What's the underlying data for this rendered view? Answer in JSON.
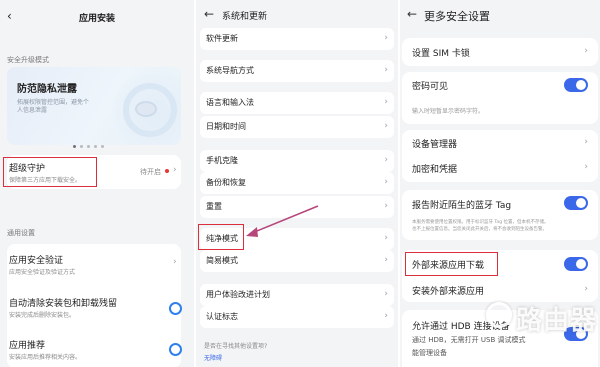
{
  "left": {
    "title": "应用安装",
    "security_mode_section": "安全升级模式",
    "banner": {
      "title": "防范隐私泄露",
      "desc_line1": "拓展权限管控范围，避免个",
      "desc_line2": "人信息泄露",
      "page_count": 5,
      "active_page": 1
    },
    "super_guard": {
      "title": "超级守护",
      "subtitle": "保障第三方应用下载安全。",
      "status": "待开启"
    },
    "general_section": "通用设置",
    "items": [
      {
        "title": "应用安全验证",
        "subtitle": "应用安全验证及验证方式"
      },
      {
        "title": "自动清除安装包和卸载残留",
        "subtitle": "安装完成后删除安装包。"
      },
      {
        "title": "应用推荐",
        "subtitle": "安装应用后推荐相关内容。"
      }
    ]
  },
  "middle": {
    "title": "系统和更新",
    "rows": [
      "软件更新",
      "系统导航方式",
      "语言和输入法",
      "日期和时间",
      "手机克隆",
      "备份和恢复",
      "重置",
      "纯净模式",
      "简易模式",
      "用户体验改进计划",
      "认证标志"
    ],
    "footer_q": "是否在寻找其他设置项?",
    "footer_link": "无障碍"
  },
  "right": {
    "title": "更多安全设置",
    "sim_lock": "设置 SIM 卡锁",
    "password_visible": {
      "label": "密码可见",
      "subtitle": "输入时短暂显示密码字符。"
    },
    "device_admin": "设备管理器",
    "encryption": "加密和凭据",
    "bluetooth_tag": {
      "label": "报告附近陌生的蓝牙 Tag",
      "desc_line1": "本服务需要使用位置权限。用于标识蓝牙 Tag 位置，但本机不存储。",
      "desc_line2": "也不上报位置信息。当您关闭此开关后，将不会收到陌生设备告警。"
    },
    "external_download": "外部来源应用下载",
    "install_external": "安装外部来源应用",
    "hdb": {
      "label": "允许通过 HDB 连接设备",
      "line2": "通过 HDB，无需打开 USB 调试模式",
      "line3": "能管理设备"
    }
  },
  "watermark": "路由器",
  "colors": {
    "accent": "#3b68e8",
    "highlight_box": "#d9303b",
    "arrow": "#b5477c"
  }
}
